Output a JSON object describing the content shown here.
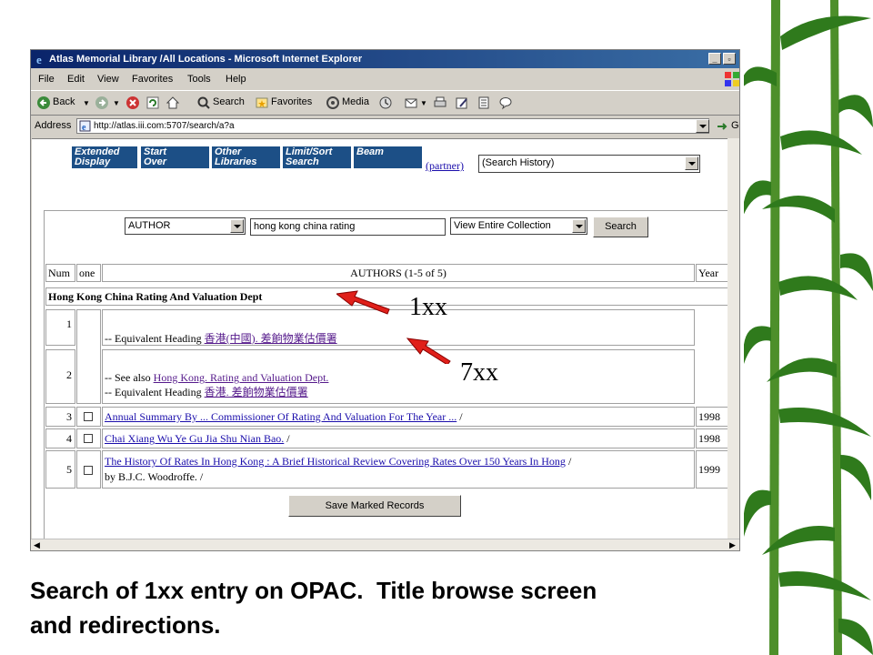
{
  "window": {
    "title": "Atlas Memorial Library /All Locations - Microsoft Internet Explorer",
    "controls": [
      "_",
      "▫",
      "×"
    ]
  },
  "menu": [
    "File",
    "Edit",
    "View",
    "Favorites",
    "Tools",
    "Help"
  ],
  "toolbar": {
    "back": "Back",
    "search": "Search",
    "favorites": "Favorites",
    "media": "Media"
  },
  "address": {
    "label": "Address",
    "url": "http://atlas.iii.com:5707/search/a?a",
    "go": "G"
  },
  "opac": {
    "nav_buttons": [
      {
        "line1": "Extended",
        "line2": "Display"
      },
      {
        "line1": "Start",
        "line2": "Over"
      },
      {
        "line1": "Other",
        "line2": "Libraries"
      },
      {
        "line1": "Limit/Sort",
        "line2": "Search"
      },
      {
        "line1": "Beam",
        "line2": ""
      }
    ],
    "partner_link": "(partner)",
    "history_select": "(Search History)",
    "search_type": "AUTHOR",
    "search_query": "hong kong china rating",
    "collection": "View Entire Collection",
    "search_button": "Search",
    "table": {
      "headers": {
        "num": "Num",
        "one": "one",
        "authors": "AUTHORS (1-5 of 5)",
        "year": "Year"
      },
      "heading": "Hong Kong China Rating And Valuation Dept",
      "rows": [
        {
          "num": "1",
          "prefix": "-- Equivalent Heading ",
          "link": "香港(中國). 差餉物業估價署"
        },
        {
          "num": "2",
          "line1_prefix": "-- See also ",
          "line1_link": "Hong Kong. Rating and Valuation Dept.",
          "line2_prefix": "-- Equivalent Heading ",
          "line2_link": "香港. 差餉物業估價署"
        },
        {
          "num": "3",
          "link": "Annual Summary By ... Commissioner Of Rating And Valuation For The Year ...",
          "suffix": " /",
          "year": "1998"
        },
        {
          "num": "4",
          "link": "Chai Xiang Wu Ye Gu Jia Shu Nian Bao.",
          "suffix": " /",
          "year": "1998"
        },
        {
          "num": "5",
          "link": "The History Of Rates In Hong Kong : A Brief Historical Review Covering Rates Over 150 Years In Hong",
          "suffix": " /",
          "line2": "by B.J.C. Woodroffe. /",
          "year": "1999"
        }
      ]
    },
    "save_button": "Save Marked Records"
  },
  "annotations": {
    "label_1xx": "1xx",
    "label_7xx": "7xx",
    "arrow_color": "#e0201a"
  },
  "caption": {
    "line1": "Search of 1xx entry on OPAC.  Title browse screen",
    "line2": "and redirections."
  },
  "colors": {
    "nav_button": "#1c4f86",
    "title_bar": "#0a246a",
    "link": "#1a0dab",
    "visited_link": "#551a8b",
    "bamboo": "#2f7a1c"
  }
}
